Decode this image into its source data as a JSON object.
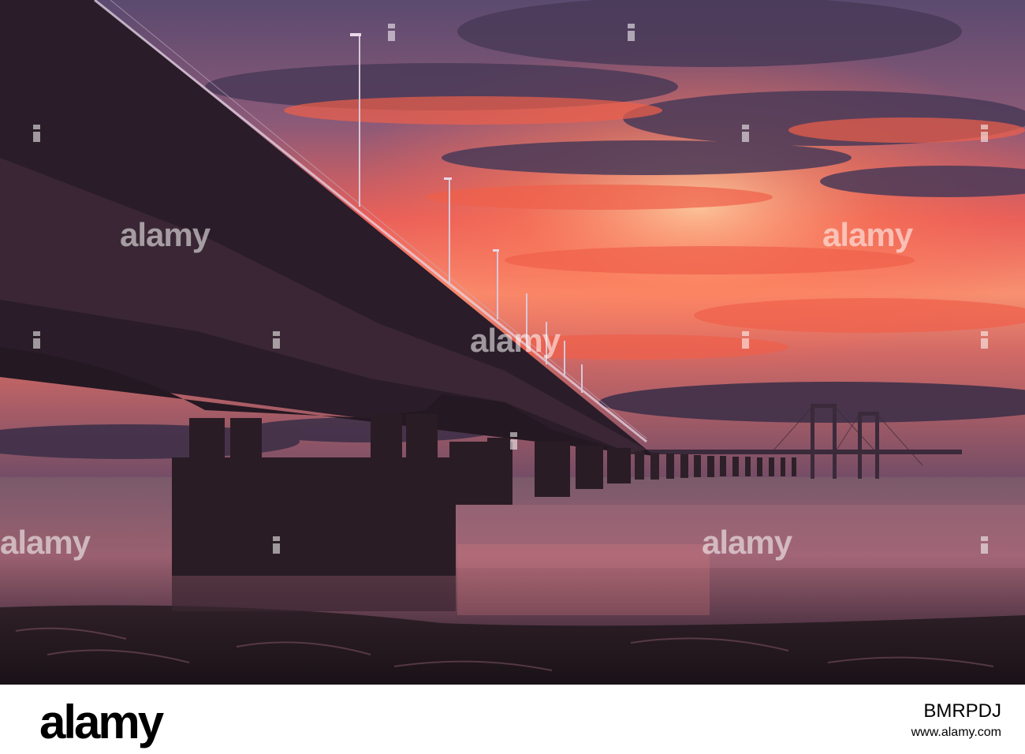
{
  "photo": {
    "subject": "bridge-at-sunset",
    "colors": {
      "sky_top": "#6a5a82",
      "sky_glow": "#f25a44",
      "cloud_dark": "#3e3048",
      "water": "#6e4a58",
      "silhouette": "#241822"
    }
  },
  "watermark": {
    "text": "alamy"
  },
  "footer": {
    "logo": "alamy",
    "stock_id": "BMRPDJ",
    "site": "www.alamy.com"
  }
}
